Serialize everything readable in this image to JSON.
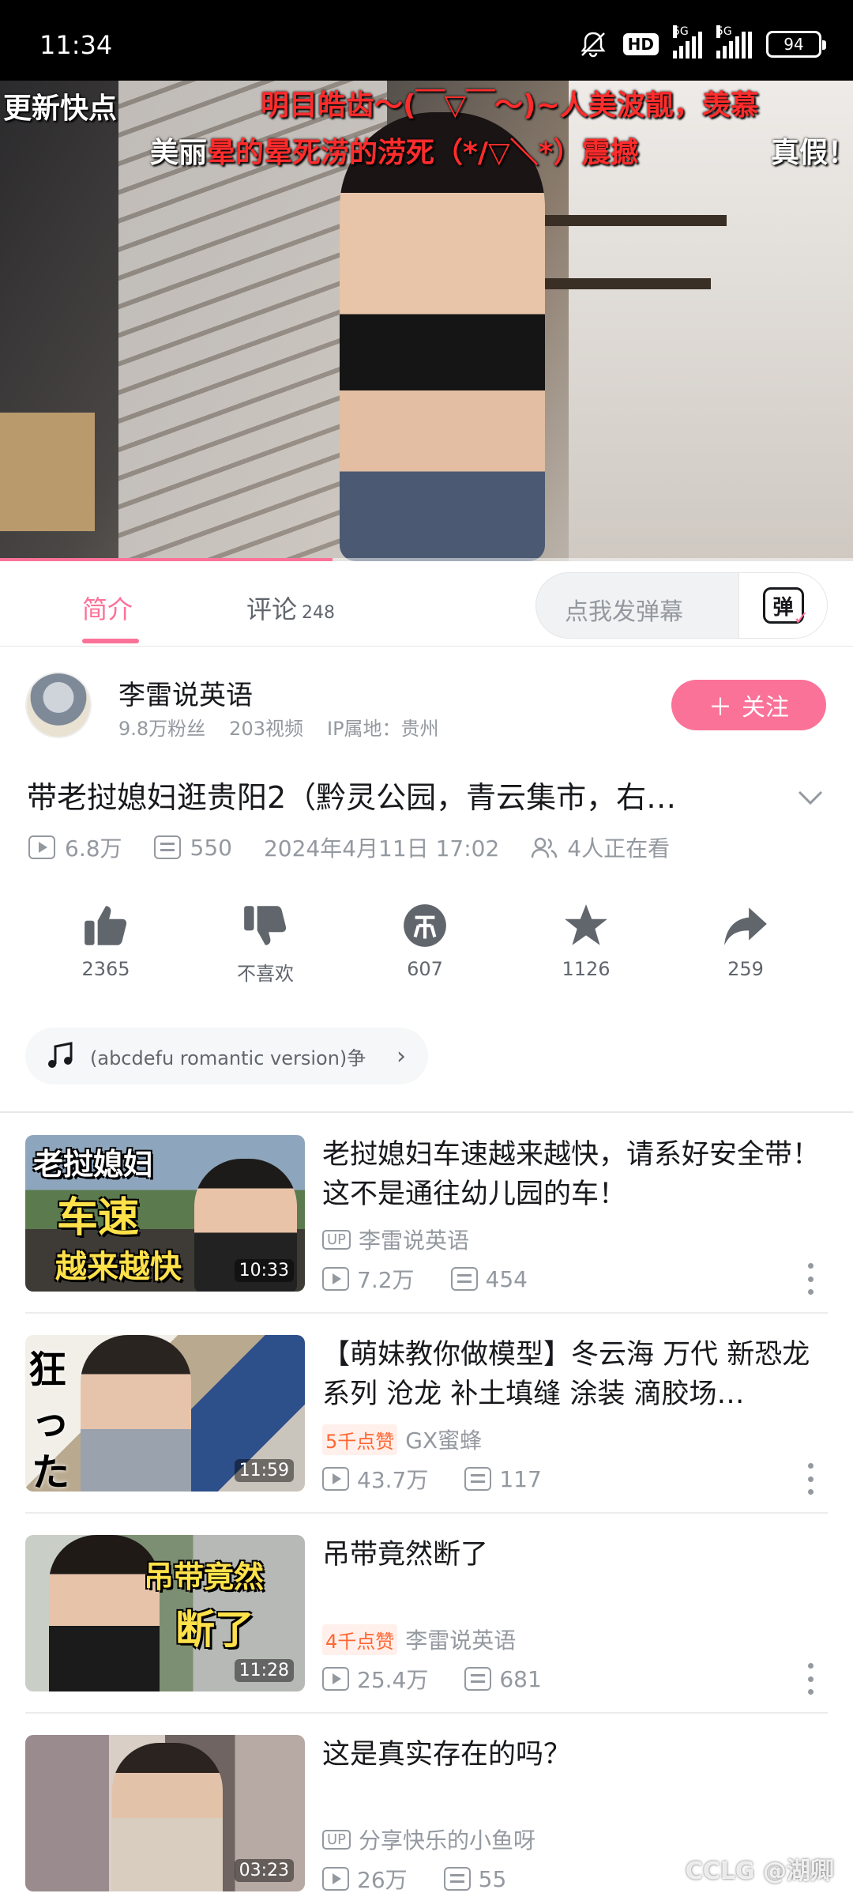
{
  "status_bar": {
    "time": "11:34",
    "hd_label": "HD",
    "network_1": "5G",
    "network_2": "5G",
    "battery": "94"
  },
  "player": {
    "danmaku": [
      "更新快点",
      "明目皓齿～(￣▽￣～)~人美波靓，羡慕",
      "美丽",
      "晕的晕死涝的涝死（*/▽＼*）震撼",
      "真假！"
    ],
    "progress": 0.39
  },
  "tabs": {
    "intro": "简介",
    "comments": "评论",
    "comments_count": "248",
    "danmaku_placeholder": "点我发弹幕",
    "danmaku_button": "弹"
  },
  "uploader": {
    "name": "李雷说英语",
    "followers": "9.8万粉丝",
    "videos": "203视频",
    "ip": "IP属地：贵州",
    "follow_label": "关注"
  },
  "video": {
    "title": "带老挝媳妇逛贵阳2（黔灵公园，青云集市，右…",
    "views": "6.8万",
    "danmaku_count": "550",
    "date": "2024年4月11日 17:02",
    "watching": "4人正在看"
  },
  "actions": {
    "like": "2365",
    "dislike": "不喜欢",
    "coin": "607",
    "favorite": "1126",
    "share": "259"
  },
  "music": {
    "text": "(abcdefu romantic version)争"
  },
  "recommendations": [
    {
      "title": "老挝媳妇车速越来越快，请系好安全带！这不是通往幼儿园的车！",
      "badge": "UP",
      "author": "李雷说英语",
      "views": "7.2万",
      "danmaku": "454",
      "duration": "10:33",
      "overlay": [
        "老挝媳妇",
        "车速",
        "越来越快"
      ]
    },
    {
      "title": "【萌妹教你做模型】冬云海 万代 新恐龙系列 沧龙 补土填缝 涂装 滴胶场…",
      "like_tag": "5千点赞",
      "author": "GX蜜蜂",
      "views": "43.7万",
      "danmaku": "117",
      "duration": "11:59",
      "overlay": [
        "狂",
        "っ",
        "た"
      ]
    },
    {
      "title": "吊带竟然断了",
      "like_tag": "4千点赞",
      "author": "李雷说英语",
      "views": "25.4万",
      "danmaku": "681",
      "duration": "11:28",
      "overlay": [
        "吊带竟然",
        "断了"
      ]
    },
    {
      "title": "这是真实存在的吗？",
      "badge": "UP",
      "author": "分享快乐的小鱼呀",
      "views": "26万",
      "danmaku": "55",
      "duration": "03:23"
    }
  ],
  "watermark": "CCLG @湖卿",
  "colors": {
    "accent": "#fb7299",
    "text_primary": "#18191c",
    "text_secondary": "#9499a0",
    "like_tag": "#ff6633"
  }
}
